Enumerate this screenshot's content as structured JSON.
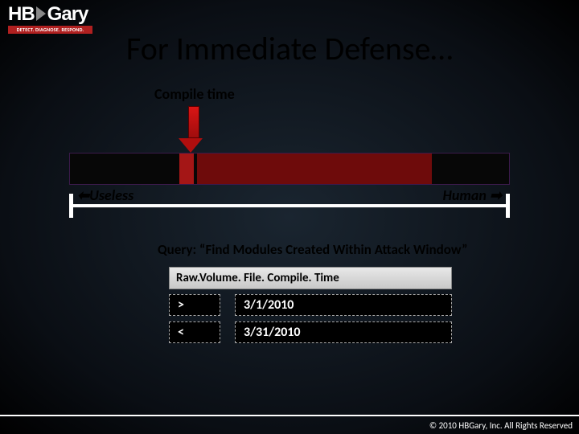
{
  "logo": {
    "brand_left": "HB",
    "brand_right": "Gary",
    "tagline": "DETECT. DIAGNOSE. RESPOND."
  },
  "title": "For Immediate Defense…",
  "compile_label": "Compile time",
  "axis": {
    "left": "⬅Useless",
    "right": "Human ➡"
  },
  "query_label": "Query: “Find Modules Created Within Attack Window”",
  "field_header": "Raw.Volume. File. Compile. Time",
  "rows": [
    {
      "op": ">",
      "value": "3/1/2010"
    },
    {
      "op": "<",
      "value": "3/31/2010"
    }
  ],
  "footer": "© 2010 HBGary, Inc. All Rights Reserved"
}
